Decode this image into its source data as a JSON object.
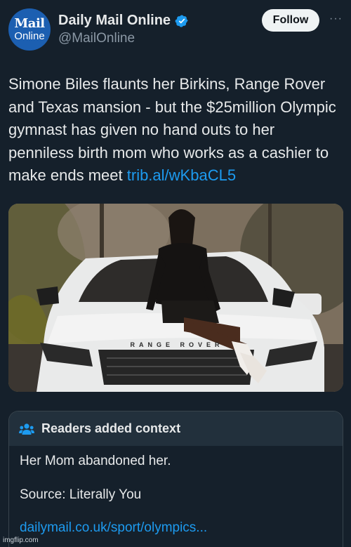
{
  "account": {
    "avatar_line1": "Mail",
    "avatar_line2": "Online",
    "display_name": "Daily Mail Online",
    "handle": "@MailOnline",
    "verified": true
  },
  "actions": {
    "follow_label": "Follow",
    "more_label": "···"
  },
  "tweet": {
    "text": "Simone Biles flaunts her Birkins, Range Rover and Texas mansion - but the $25million Olympic gymnast has given no hand outs to her penniless birth mom who works as a cashier to make ends meet ",
    "link": "trib.al/wKbaCL5"
  },
  "media": {
    "car_badge": "RANGE ROVER"
  },
  "context": {
    "title": "Readers added context",
    "note": "Her Mom abandoned her.",
    "source": "Source: Literally You",
    "link": "dailymail.co.uk/sport/olympics..."
  },
  "watermark": "imgflip.com",
  "colors": {
    "background": "#15202b",
    "link": "#1d9bf0",
    "verified": "#1d9bf0",
    "avatar": "#1c5fb1"
  }
}
